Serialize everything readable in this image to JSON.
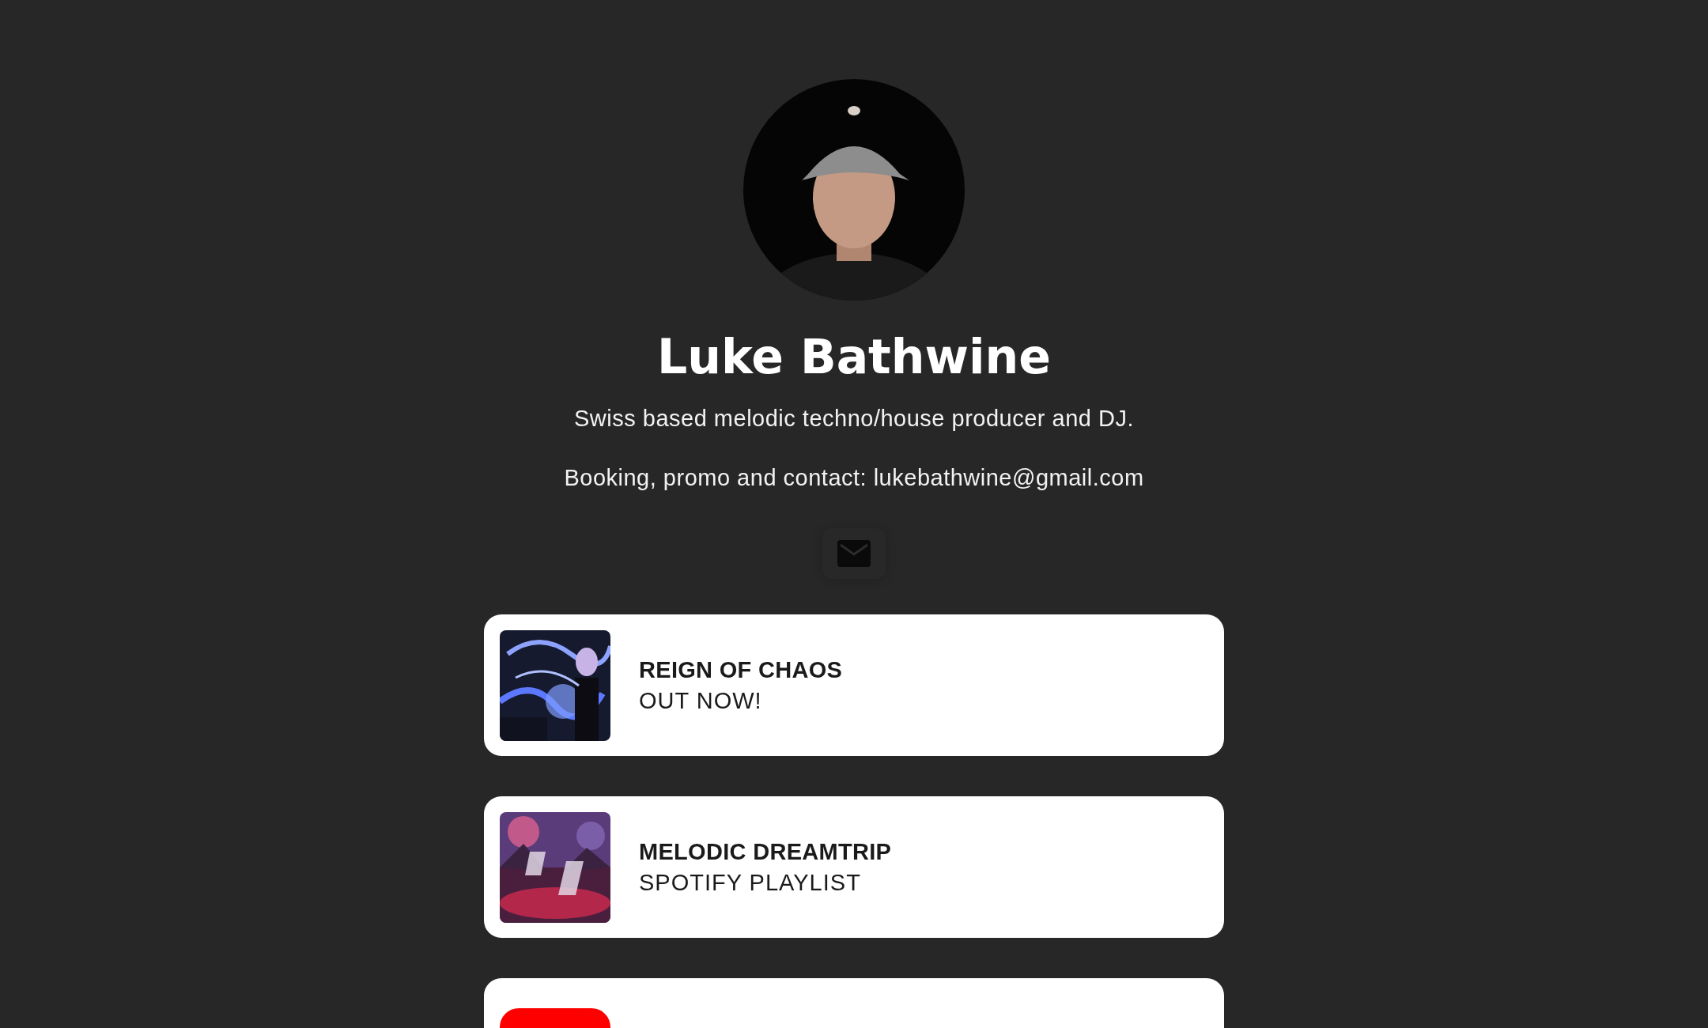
{
  "profile": {
    "name": "Luke Bathwine",
    "bio": "Swiss based melodic techno/house producer and DJ.",
    "contact": "Booking, promo and contact: lukebathwine@gmail.com"
  },
  "social": [
    {
      "kind": "email"
    }
  ],
  "links": [
    {
      "kind": "picture",
      "title": "REIGN OF CHAOS",
      "subtitle": "OUT NOW!"
    },
    {
      "kind": "picture",
      "title": "MELODIC DREAMTRIP",
      "subtitle": "SPOTIFY PLAYLIST"
    },
    {
      "kind": "logo"
    }
  ]
}
